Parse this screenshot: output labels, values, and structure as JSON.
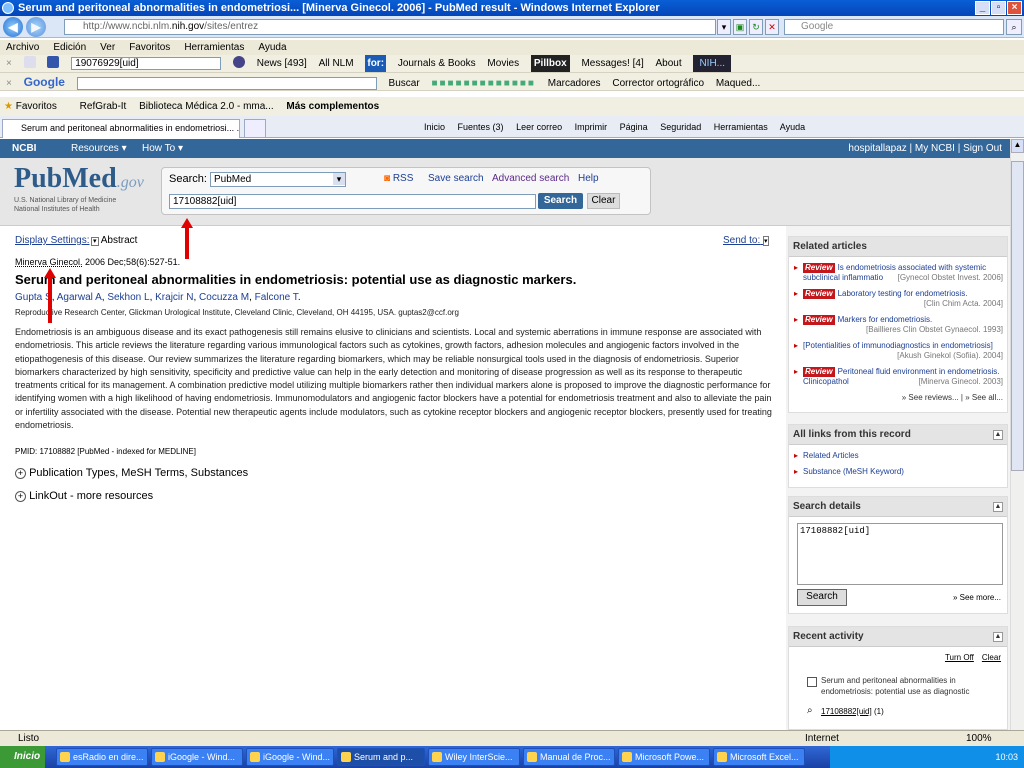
{
  "window": {
    "title": "Serum and peritoneal abnormalities in endometriosi... [Minerva Ginecol. 2006] - PubMed result - Windows Internet Explorer"
  },
  "address": {
    "url_prefix": "http://www.ncbi.nlm.",
    "url_domain": "nih.gov",
    "url_suffix": "/sites/entrez",
    "search_placeholder": "Google"
  },
  "menu": [
    "Archivo",
    "Edición",
    "Ver",
    "Favoritos",
    "Herramientas",
    "Ayuda"
  ],
  "toolbar1": {
    "query": "19076929[uid]",
    "items": [
      "News [493]",
      "All NLM",
      "for:",
      "Journals & Books",
      "Movies",
      "Pillbox",
      "Messages! [4]",
      "About",
      "NIH..."
    ]
  },
  "toolbar2": {
    "brand": "Google",
    "items": [
      "Buscar",
      "Marcadores",
      "Corrector ortográfico",
      "Maqued..."
    ]
  },
  "favorites": {
    "label": "Favoritos",
    "items": [
      "RefGrab-It",
      "Biblioteca Médica 2.0 - mma...",
      "Más complementos"
    ]
  },
  "tab": {
    "label": "Serum and peritoneal abnormalities in endometriosi... ..."
  },
  "commandbar": [
    "Inicio",
    "Fuentes (3)",
    "Leer correo",
    "Imprimir",
    "Página",
    "Seguridad",
    "Herramientas",
    "Ayuda"
  ],
  "ncbi": {
    "logo": "NCBI",
    "resources": "Resources",
    "howto": "How To",
    "user": "hospitallapaz",
    "myncbi": "My NCBI",
    "signout": "Sign Out"
  },
  "pubmed": {
    "logo": "PubMed",
    "gov": ".gov",
    "sub1": "U.S. National Library of Medicine",
    "sub2": "National Institutes of Health",
    "search_label": "Search:",
    "db": "PubMed",
    "rss": "RSS",
    "save": "Save search",
    "advanced": "Advanced search",
    "help": "Help",
    "term": "17108882[uid]",
    "search_btn": "Search",
    "clear_btn": "Clear"
  },
  "display": {
    "settings": "Display Settings:",
    "mode": "Abstract",
    "sendto": "Send to:"
  },
  "article": {
    "journal": "Minerva Ginecol.",
    "citation": " 2006 Dec;58(6):527-51.",
    "title": "Serum and peritoneal abnormalities in endometriosis: potential use as diagnostic markers.",
    "authors": [
      "Gupta S",
      "Agarwal A",
      "Sekhon L",
      "Krajcir N",
      "Cocuzza M",
      "Falcone T"
    ],
    "affiliation": "Reproductive Research Center, Glickman Urological Institute, Cleveland Clinic, Cleveland, OH 44195, USA. guptas2@ccf.org",
    "abstract": "Endometriosis is an ambiguous disease and its exact pathogenesis still remains elusive to clinicians and scientists. Local and systemic aberrations in immune response are associated with endometriosis. This article reviews the literature regarding various immunological factors such as cytokines, growth factors, adhesion molecules and angiogenic factors involved in the etiopathogenesis of this disease. Our review summarizes the literature regarding biomarkers, which may be reliable nonsurgical tools used in the diagnosis of endometriosis. Superior biomarkers characterized by high sensitivity, specificity and predictive value can help in the early detection and monitoring of disease progression as well as its response to therapeutic treatments critical for its management. A combination predictive model utilizing multiple biomarkers rather then individual markers alone is proposed to improve the diagnostic performance for identifying women with a high likelihood of having endometriosis. Immunomodulators and angiogenic factor blockers have a potential for endometriosis treatment and also to alleviate the pain or infertility associated with the disease. Potential new therapeutic agents include modulators, such as cytokine receptor blockers and angiogenic receptor blockers, presently used for treating endometriosis.",
    "pmid": "PMID: 17108882 [PubMed - indexed for MEDLINE]",
    "pubtypes": "Publication Types, MeSH Terms, Substances",
    "linkout": "LinkOut - more resources"
  },
  "related": {
    "title": "Related articles",
    "review_tag": "Review",
    "items": [
      {
        "review": true,
        "text": "Is endometriosis associated with systemic subclinical inflammatio",
        "src": "[Gynecol Obstet Invest. 2006]"
      },
      {
        "review": true,
        "text": "Laboratory testing for endometriosis.",
        "src": "[Clin Chim Acta. 2004]"
      },
      {
        "review": true,
        "text": "Markers for endometriosis.",
        "src": "[Baillieres Clin Obstet Gynaecol. 1993]"
      },
      {
        "review": false,
        "text": "[Potentialities of immunodiagnostics in endometriosis]",
        "src": "[Akush Ginekol (Sofiia). 2004]"
      },
      {
        "review": true,
        "text": "Peritoneal fluid environment in endometriosis. Clinicopathol",
        "src": "[Minerva Ginecol. 2003]"
      }
    ],
    "see_reviews": "» See reviews...",
    "see_all": "» See all..."
  },
  "alllinks": {
    "title": "All links from this record",
    "items": [
      "Related Articles",
      "Substance (MeSH Keyword)"
    ]
  },
  "searchdetails": {
    "title": "Search details",
    "query": "17108882[uid]",
    "button": "Search",
    "more": "» See more..."
  },
  "recent": {
    "title": "Recent activity",
    "turnoff": "Turn Off",
    "clear": "Clear",
    "item": "Serum and peritoneal abnormalities in endometriosis: potential use as diagnostic",
    "query": "17108882[uid]",
    "count": "(1)"
  },
  "status": {
    "left": "Listo",
    "zone": "Internet",
    "zoom": "100%"
  },
  "taskbar": {
    "start": "Inicio",
    "tasks": [
      "esRadio en dire...",
      "iGoogle - Wind...",
      "iGoogle - Wind...",
      "Serum and p...",
      "Wiley InterScie...",
      "Manual de Proc...",
      "Microsoft Powe...",
      "Microsoft Excel..."
    ],
    "clock": "10:03"
  }
}
